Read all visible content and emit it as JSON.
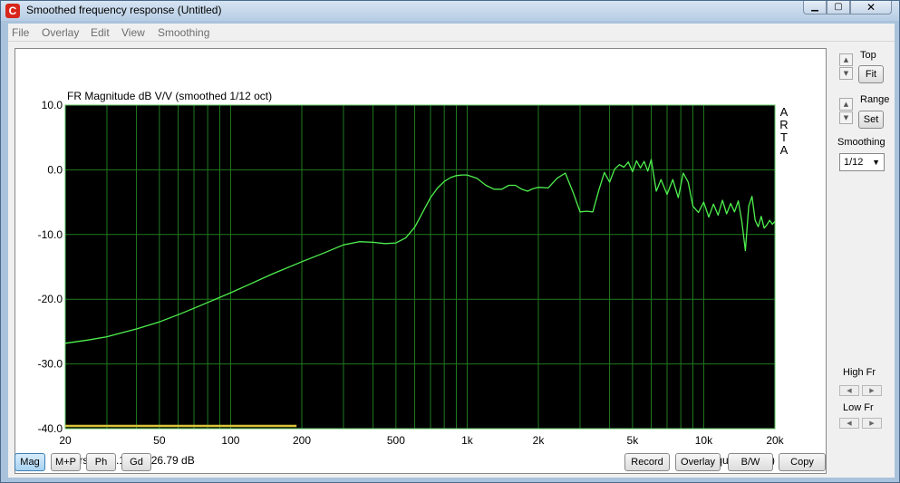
{
  "window": {
    "title": "Smoothed frequency response (Untitled)",
    "icon": "arta-app-icon",
    "minimize_icon": "minimize-icon",
    "maximize_icon": "maximize-icon",
    "close_icon": "close-icon"
  },
  "menu": {
    "items": [
      "File",
      "Overlay",
      "Edit",
      "View",
      "Smoothing"
    ]
  },
  "side_panel": {
    "top_label": "Top",
    "fit_label": "Fit",
    "range_label": "Range",
    "set_label": "Set",
    "smoothing_label": "Smoothing",
    "smoothing_value": "1/12",
    "high_fr_label": "High Fr",
    "low_fr_label": "Low Fr"
  },
  "bottom_buttons": {
    "mag": "Mag",
    "mp": "M+P",
    "ph": "Ph",
    "gd": "Gd",
    "record": "Record",
    "overlay": "Overlay",
    "bw": "B/W",
    "copy": "Copy"
  },
  "colors": {
    "plot_bg": "#000000",
    "grid": "#1f7a1f",
    "frame": "#5bc25b",
    "curve": "#4ef04e",
    "marker": "#d9c43a"
  },
  "chart_data": {
    "type": "line",
    "title": "FR Magnitude dB V/V (smoothed 1/12 oct)",
    "xlabel": "Frequency (Hz)",
    "ylabel": "",
    "watermark": "ARTA",
    "cursor_text": "Cursor: 20.1 Hz, -26.79 dB",
    "x_scale": "log",
    "xlim": [
      20,
      20000
    ],
    "ylim": [
      -40,
      10
    ],
    "grid": true,
    "x_ticks": [
      20,
      50,
      100,
      200,
      500,
      1000,
      2000,
      5000,
      10000,
      20000
    ],
    "x_tick_labels": [
      "20",
      "50",
      "100",
      "200",
      "500",
      "1k",
      "2k",
      "5k",
      "10k",
      "20k"
    ],
    "y_ticks": [
      -40,
      -30,
      -20,
      -10,
      0,
      10
    ],
    "y_tick_labels": [
      "-40.0",
      "-30.0",
      "-20.0",
      "-10.0",
      "0.0",
      "10.0"
    ],
    "series": [
      {
        "x": [
          20,
          25,
          30,
          40,
          50,
          60,
          70,
          80,
          100,
          120,
          150,
          200,
          250,
          300,
          350,
          400,
          450,
          500,
          550,
          600,
          650,
          700,
          750,
          800,
          850,
          900,
          950,
          1000,
          1100,
          1200,
          1300,
          1400,
          1500,
          1600,
          1700,
          1800,
          1900,
          2000,
          2200,
          2400,
          2600,
          2800,
          3000,
          3200,
          3400,
          3600,
          3800,
          4000,
          4200,
          4400,
          4600,
          4800,
          5000,
          5200,
          5400,
          5600,
          5800,
          6000,
          6300,
          6600,
          7000,
          7400,
          7800,
          8200,
          8600,
          9000,
          9500,
          10000,
          10500,
          11000,
          11500,
          12000,
          12500,
          13000,
          13500,
          14000,
          14500,
          15000,
          15500,
          16000,
          16500,
          17000,
          17500,
          18000,
          18500,
          19000,
          19500,
          20000
        ],
        "y": [
          -26.8,
          -26.3,
          -25.8,
          -24.6,
          -23.5,
          -22.4,
          -21.4,
          -20.5,
          -19.0,
          -17.7,
          -16.1,
          -14.2,
          -12.8,
          -11.6,
          -11.1,
          -11.2,
          -11.4,
          -11.3,
          -10.5,
          -8.9,
          -6.5,
          -4.3,
          -2.8,
          -1.8,
          -1.2,
          -0.9,
          -0.8,
          -0.8,
          -1.3,
          -2.4,
          -3.0,
          -3.0,
          -2.4,
          -2.4,
          -3.0,
          -3.3,
          -2.9,
          -2.7,
          -2.8,
          -1.3,
          -0.5,
          -3.4,
          -6.5,
          -6.4,
          -6.5,
          -3.2,
          -0.4,
          -1.9,
          0.1,
          0.8,
          0.4,
          1.2,
          -0.3,
          1.4,
          0.3,
          1.3,
          -0.2,
          1.6,
          -3.3,
          -1.5,
          -3.8,
          -1.5,
          -4.3,
          -0.5,
          -1.9,
          -5.6,
          -6.6,
          -5.0,
          -7.3,
          -5.3,
          -7.0,
          -4.7,
          -6.8,
          -5.2,
          -6.5,
          -4.8,
          -8.0,
          -12.5,
          -5.6,
          -4.1,
          -7.8,
          -8.8,
          -7.2,
          -9.0,
          -8.5,
          -7.8,
          -8.4,
          -8.0
        ]
      }
    ],
    "marker_line": {
      "x_start": 20,
      "x_end": 190,
      "y": -40
    }
  }
}
